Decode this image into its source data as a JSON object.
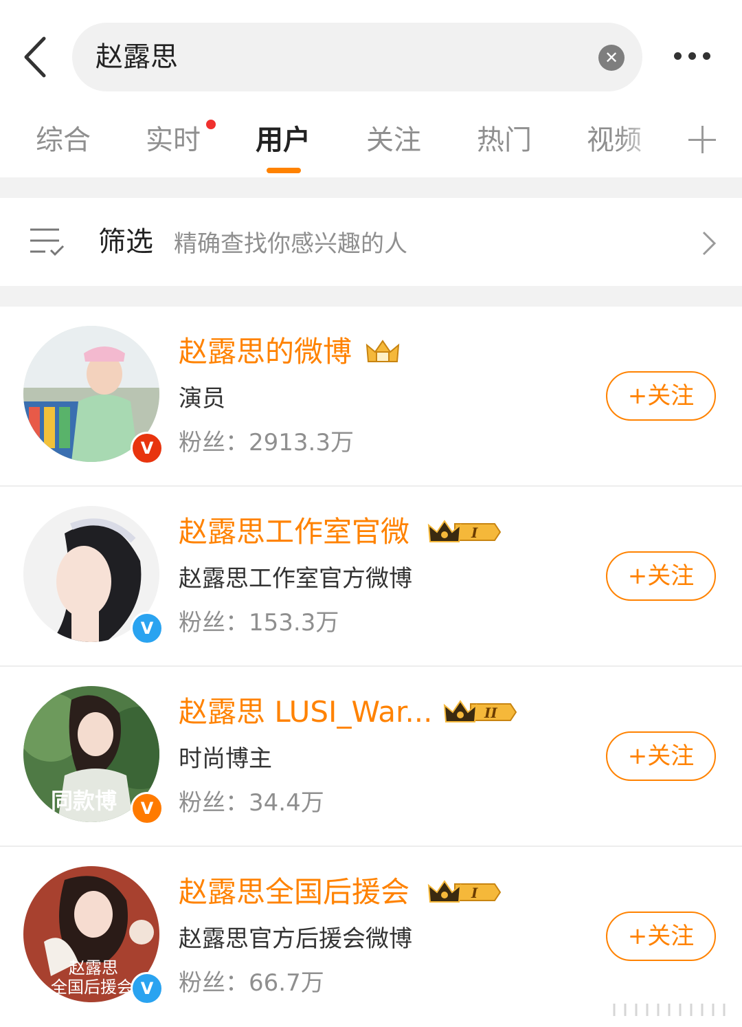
{
  "search": {
    "query": "赵露思"
  },
  "tabs": [
    {
      "label": "综合"
    },
    {
      "label": "实时"
    },
    {
      "label": "用户"
    },
    {
      "label": "关注"
    },
    {
      "label": "热门"
    },
    {
      "label": "视频"
    }
  ],
  "active_tab": "用户",
  "filter": {
    "title": "筛选",
    "description": "精确查找你感兴趣的人"
  },
  "users": [
    {
      "name": "赵露思的微博",
      "description": "演员",
      "fans": "粉丝：2913.3万",
      "follow_label": "+关注",
      "verify_color": "#e8340e",
      "crown_level": ""
    },
    {
      "name": "赵露思工作室官微",
      "description": "赵露思工作室官方微博",
      "fans": "粉丝：153.3万",
      "follow_label": "+关注",
      "verify_color": "#2aa3f0",
      "crown_level": "I"
    },
    {
      "name": "赵露思 LUSI_War...",
      "description": "时尚博主",
      "fans": "粉丝：34.4万",
      "follow_label": "+关注",
      "verify_color": "#ff7a00",
      "crown_level": "II"
    },
    {
      "name": "赵露思全国后援会",
      "description": "赵露思官方后援会微博",
      "fans": "粉丝：66.7万",
      "follow_label": "+关注",
      "verify_color": "#2aa3f0",
      "crown_level": "I"
    }
  ],
  "avatar_texts": {
    "studio_overlay": "同款博",
    "fanclub_line1": "赵露思",
    "fanclub_line2": "全国后援会"
  },
  "colors": {
    "accent": "#ff8200",
    "inactive_tab": "#8f8f8f",
    "notification": "#f0312e"
  }
}
